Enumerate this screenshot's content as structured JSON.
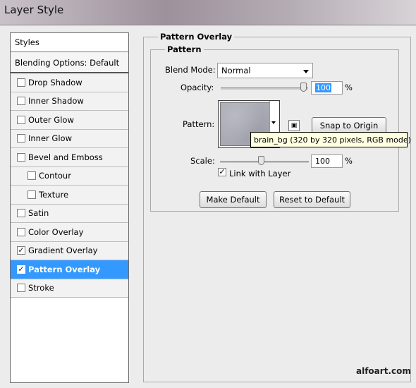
{
  "window": {
    "title": "Layer Style"
  },
  "sidebar": {
    "header": "Styles",
    "blending_options": "Blending Options: Default",
    "items": [
      {
        "label": "Drop Shadow",
        "checked": false,
        "sub": false,
        "selected": false
      },
      {
        "label": "Inner Shadow",
        "checked": false,
        "sub": false,
        "selected": false
      },
      {
        "label": "Outer Glow",
        "checked": false,
        "sub": false,
        "selected": false
      },
      {
        "label": "Inner Glow",
        "checked": false,
        "sub": false,
        "selected": false
      },
      {
        "label": "Bevel and Emboss",
        "checked": false,
        "sub": false,
        "selected": false
      },
      {
        "label": "Contour",
        "checked": false,
        "sub": true,
        "selected": false
      },
      {
        "label": "Texture",
        "checked": false,
        "sub": true,
        "selected": false
      },
      {
        "label": "Satin",
        "checked": false,
        "sub": false,
        "selected": false
      },
      {
        "label": "Color Overlay",
        "checked": false,
        "sub": false,
        "selected": false
      },
      {
        "label": "Gradient Overlay",
        "checked": true,
        "sub": false,
        "selected": false
      },
      {
        "label": "Pattern Overlay",
        "checked": true,
        "sub": false,
        "selected": true
      },
      {
        "label": "Stroke",
        "checked": false,
        "sub": false,
        "selected": false
      }
    ],
    "check_glyph": "✓"
  },
  "panel": {
    "outer_legend": "Pattern Overlay",
    "inner_legend": "Pattern",
    "blend_mode_label": "Blend Mode:",
    "blend_mode_value": "Normal",
    "opacity_label": "Opacity:",
    "opacity_value": "100",
    "opacity_unit": "%",
    "pattern_label": "Pattern:",
    "snap_button": "Snap to Origin",
    "tooltip": "brain_bg (320 by 320 pixels, RGB mode)",
    "scale_label": "Scale:",
    "scale_value": "100",
    "scale_unit": "%",
    "link_label": "Link with Layer",
    "link_checked": true,
    "make_default": "Make Default",
    "reset_default": "Reset to Default",
    "new_preset_glyph": "▣"
  },
  "watermark": "alfoart.com",
  "colors": {
    "selected_bg": "#3399ff",
    "tooltip_bg": "#ffffe1"
  }
}
